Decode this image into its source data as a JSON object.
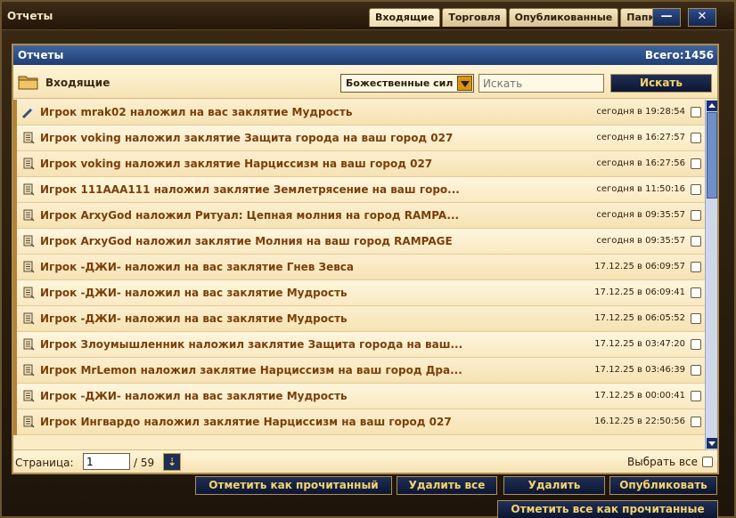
{
  "window": {
    "title": "Отчеты",
    "tabs": [
      "Входящие",
      "Торговля",
      "Опубликованные",
      "Папки"
    ],
    "active_tab": "Входящие",
    "minimize_label": "—",
    "close_label": "✕"
  },
  "panel": {
    "title": "Отчеты",
    "total": "Всего:1456"
  },
  "toolbar": {
    "folder_label": "Входящие",
    "filter_value": "Божественные сил",
    "search_placeholder": "Искать",
    "search_button": "Искать"
  },
  "messages": [
    {
      "subject": "Игрок mrak02 наложил на вас заклятие Мудрость",
      "date": "сегодня в 19:28:54",
      "icon": "magic-wand-icon"
    },
    {
      "subject": "Игрок voking наложил заклятие Защита города на ваш город 027",
      "date": "сегодня в 16:27:57",
      "icon": "scroll-icon"
    },
    {
      "subject": "Игрок voking наложил заклятие Нарциссизм на ваш город 027",
      "date": "сегодня в 16:27:56",
      "icon": "scroll-icon"
    },
    {
      "subject": "Игрок 111AAA111 наложил заклятие Землетрясение на ваш горо...",
      "date": "сегодня в 11:50:16",
      "icon": "scroll-icon"
    },
    {
      "subject": "Игрок ArxyGod наложил Ритуал: Цепная молния на город RAMPA...",
      "date": "сегодня в 09:35:57",
      "icon": "scroll-icon"
    },
    {
      "subject": "Игрок ArxyGod наложил заклятие Молния на ваш город RAMPAGE",
      "date": "сегодня в 09:35:57",
      "icon": "scroll-icon"
    },
    {
      "subject": "Игрок -ДЖИ- наложил на вас заклятие Гнев Зевса",
      "date": "17.12.25 в 06:09:57",
      "icon": "scroll-icon"
    },
    {
      "subject": "Игрок -ДЖИ- наложил на вас заклятие Мудрость",
      "date": "17.12.25 в 06:09:41",
      "icon": "scroll-icon"
    },
    {
      "subject": "Игрок -ДЖИ- наложил на вас заклятие Мудрость",
      "date": "17.12.25 в 06:05:52",
      "icon": "scroll-icon"
    },
    {
      "subject": "Игрок Злоумышленник наложил заклятие Защита города на ваш...",
      "date": "17.12.25 в 03:47:20",
      "icon": "scroll-icon"
    },
    {
      "subject": "Игрок MrLemon наложил заклятие Нарциссизм на ваш город Дра...",
      "date": "17.12.25 в 03:46:39",
      "icon": "scroll-icon"
    },
    {
      "subject": "Игрок -ДЖИ- наложил на вас заклятие Мудрость",
      "date": "17.12.25 в 00:00:41",
      "icon": "scroll-icon"
    },
    {
      "subject": "Игрок Ингвардо наложил заклятие Нарциссизм на ваш город 027",
      "date": "16.12.25 в 22:50:56",
      "icon": "scroll-icon"
    }
  ],
  "pagination": {
    "label": "Страница:",
    "current": "1",
    "total": "/ 59",
    "go_icon": "page-go-icon"
  },
  "select_all_label": "Выбрать все",
  "actions": {
    "mark_read": "Отметить как прочитанный",
    "delete_all": "Удалить все",
    "delete": "Удалить",
    "publish": "Опубликовать",
    "mark_all_read": "Отметить все как прочитанные"
  },
  "colors": {
    "header_blue": "#2a4f8c",
    "subject_text": "#7a3f0a",
    "button_text": "#f6d36d",
    "panel_bg": "#fbecc6"
  }
}
